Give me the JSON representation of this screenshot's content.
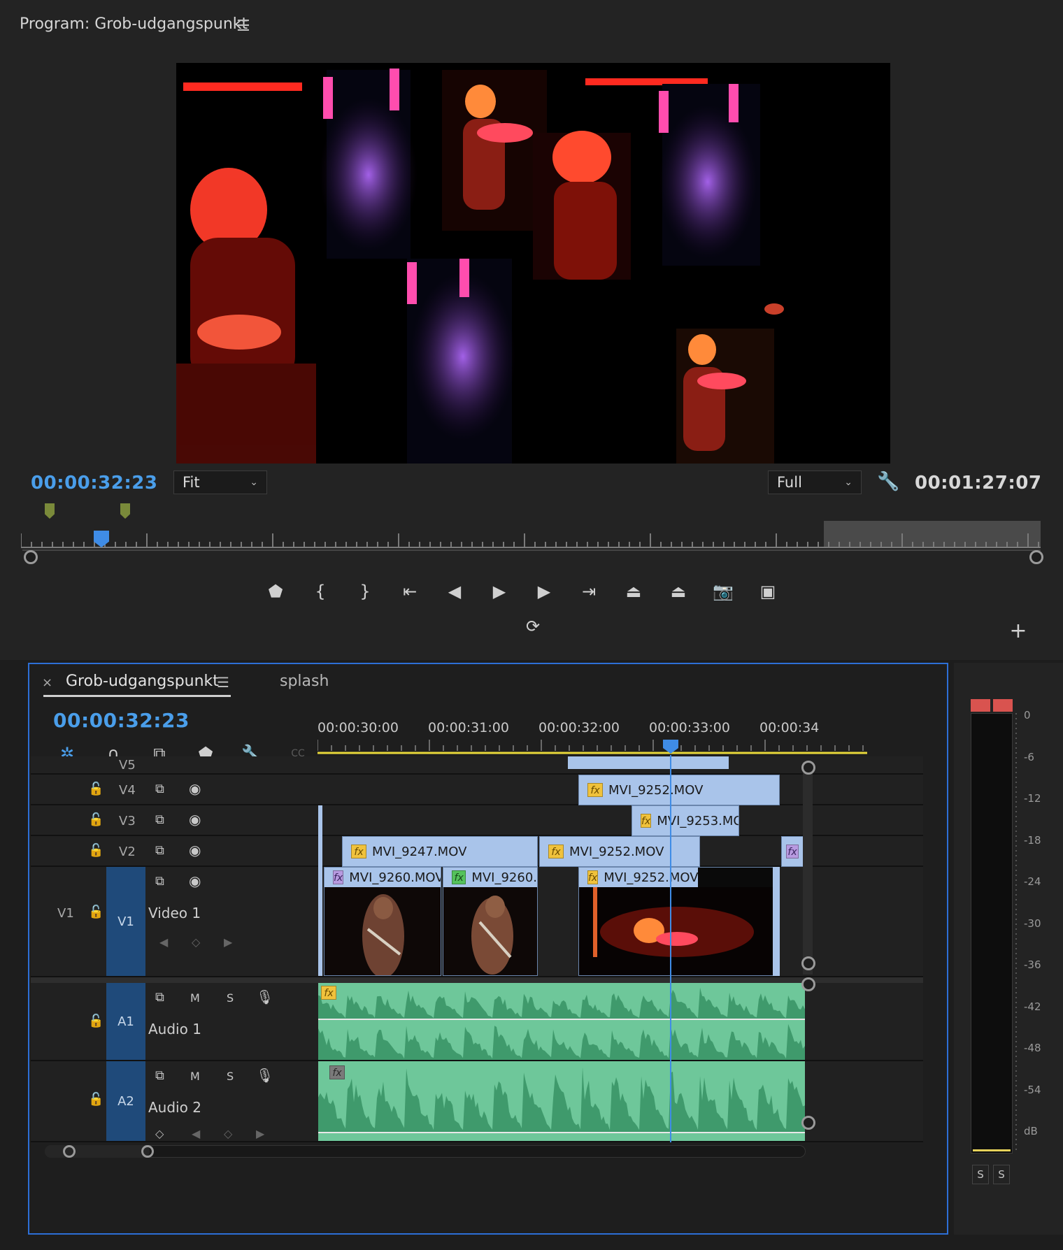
{
  "program": {
    "title": "Program: Grob-udgangspunkt",
    "menu_icon": "hamburger-icon",
    "current_time": "00:00:32:23",
    "fit_label": "Fit",
    "resolution_label": "Full",
    "duration": "00:01:27:07",
    "transport_icons": [
      "marker-icon",
      "mark-in-icon",
      "mark-out-icon",
      "go-to-in-icon",
      "step-back-icon",
      "play-icon",
      "step-forward-icon",
      "go-to-out-icon",
      "lift-icon",
      "extract-icon",
      "export-frame-icon",
      "comparison-view-icon"
    ],
    "loop_icon": "toggle-proxies-icon",
    "add_icon": "plus-icon"
  },
  "timeline": {
    "tabs": [
      {
        "label": "Grob-udgangspunkt",
        "active": true
      },
      {
        "label": "splash",
        "active": false
      }
    ],
    "close_glyph": "×",
    "current_time": "00:00:32:23",
    "ruler_labels": [
      "00:00:30:00",
      "00:00:31:00",
      "00:00:32:00",
      "00:00:33:00",
      "00:00:34"
    ],
    "tools": [
      "nest-icon",
      "snap-magnet-icon",
      "linked-selection-icon",
      "add-marker-icon",
      "timeline-settings-wrench-icon",
      "captions-icon"
    ],
    "tracks": {
      "v5": {
        "label": "V5"
      },
      "v4": {
        "label": "V4"
      },
      "v3": {
        "label": "V3"
      },
      "v2": {
        "label": "V2"
      },
      "v1": {
        "source": "V1",
        "label": "V1",
        "name": "Video 1"
      },
      "a1": {
        "label": "A1",
        "name": "Audio 1",
        "m": "M",
        "s": "S"
      },
      "a2": {
        "label": "A2",
        "name": "Audio 2",
        "m": "M",
        "s": "S"
      }
    },
    "clips": {
      "v4_1": "MVI_9252.MOV",
      "v3_1": "MVI_9253.MO",
      "v2_1": "MVI_9247.MOV",
      "v2_2": "MVI_9252.MOV",
      "v1_1": "MVI_9260.MOV",
      "v1_2": "MVI_9260.",
      "v1_3": "MVI_9252.MOV"
    },
    "fx_label": "fx"
  },
  "meters": {
    "scale": [
      "0",
      "-6",
      "-12",
      "-18",
      "-24",
      "-30",
      "-36",
      "-42",
      "-48",
      "-54",
      "dB"
    ],
    "solo_left": "S",
    "solo_right": "S",
    "peak_color": "#d9534f"
  }
}
